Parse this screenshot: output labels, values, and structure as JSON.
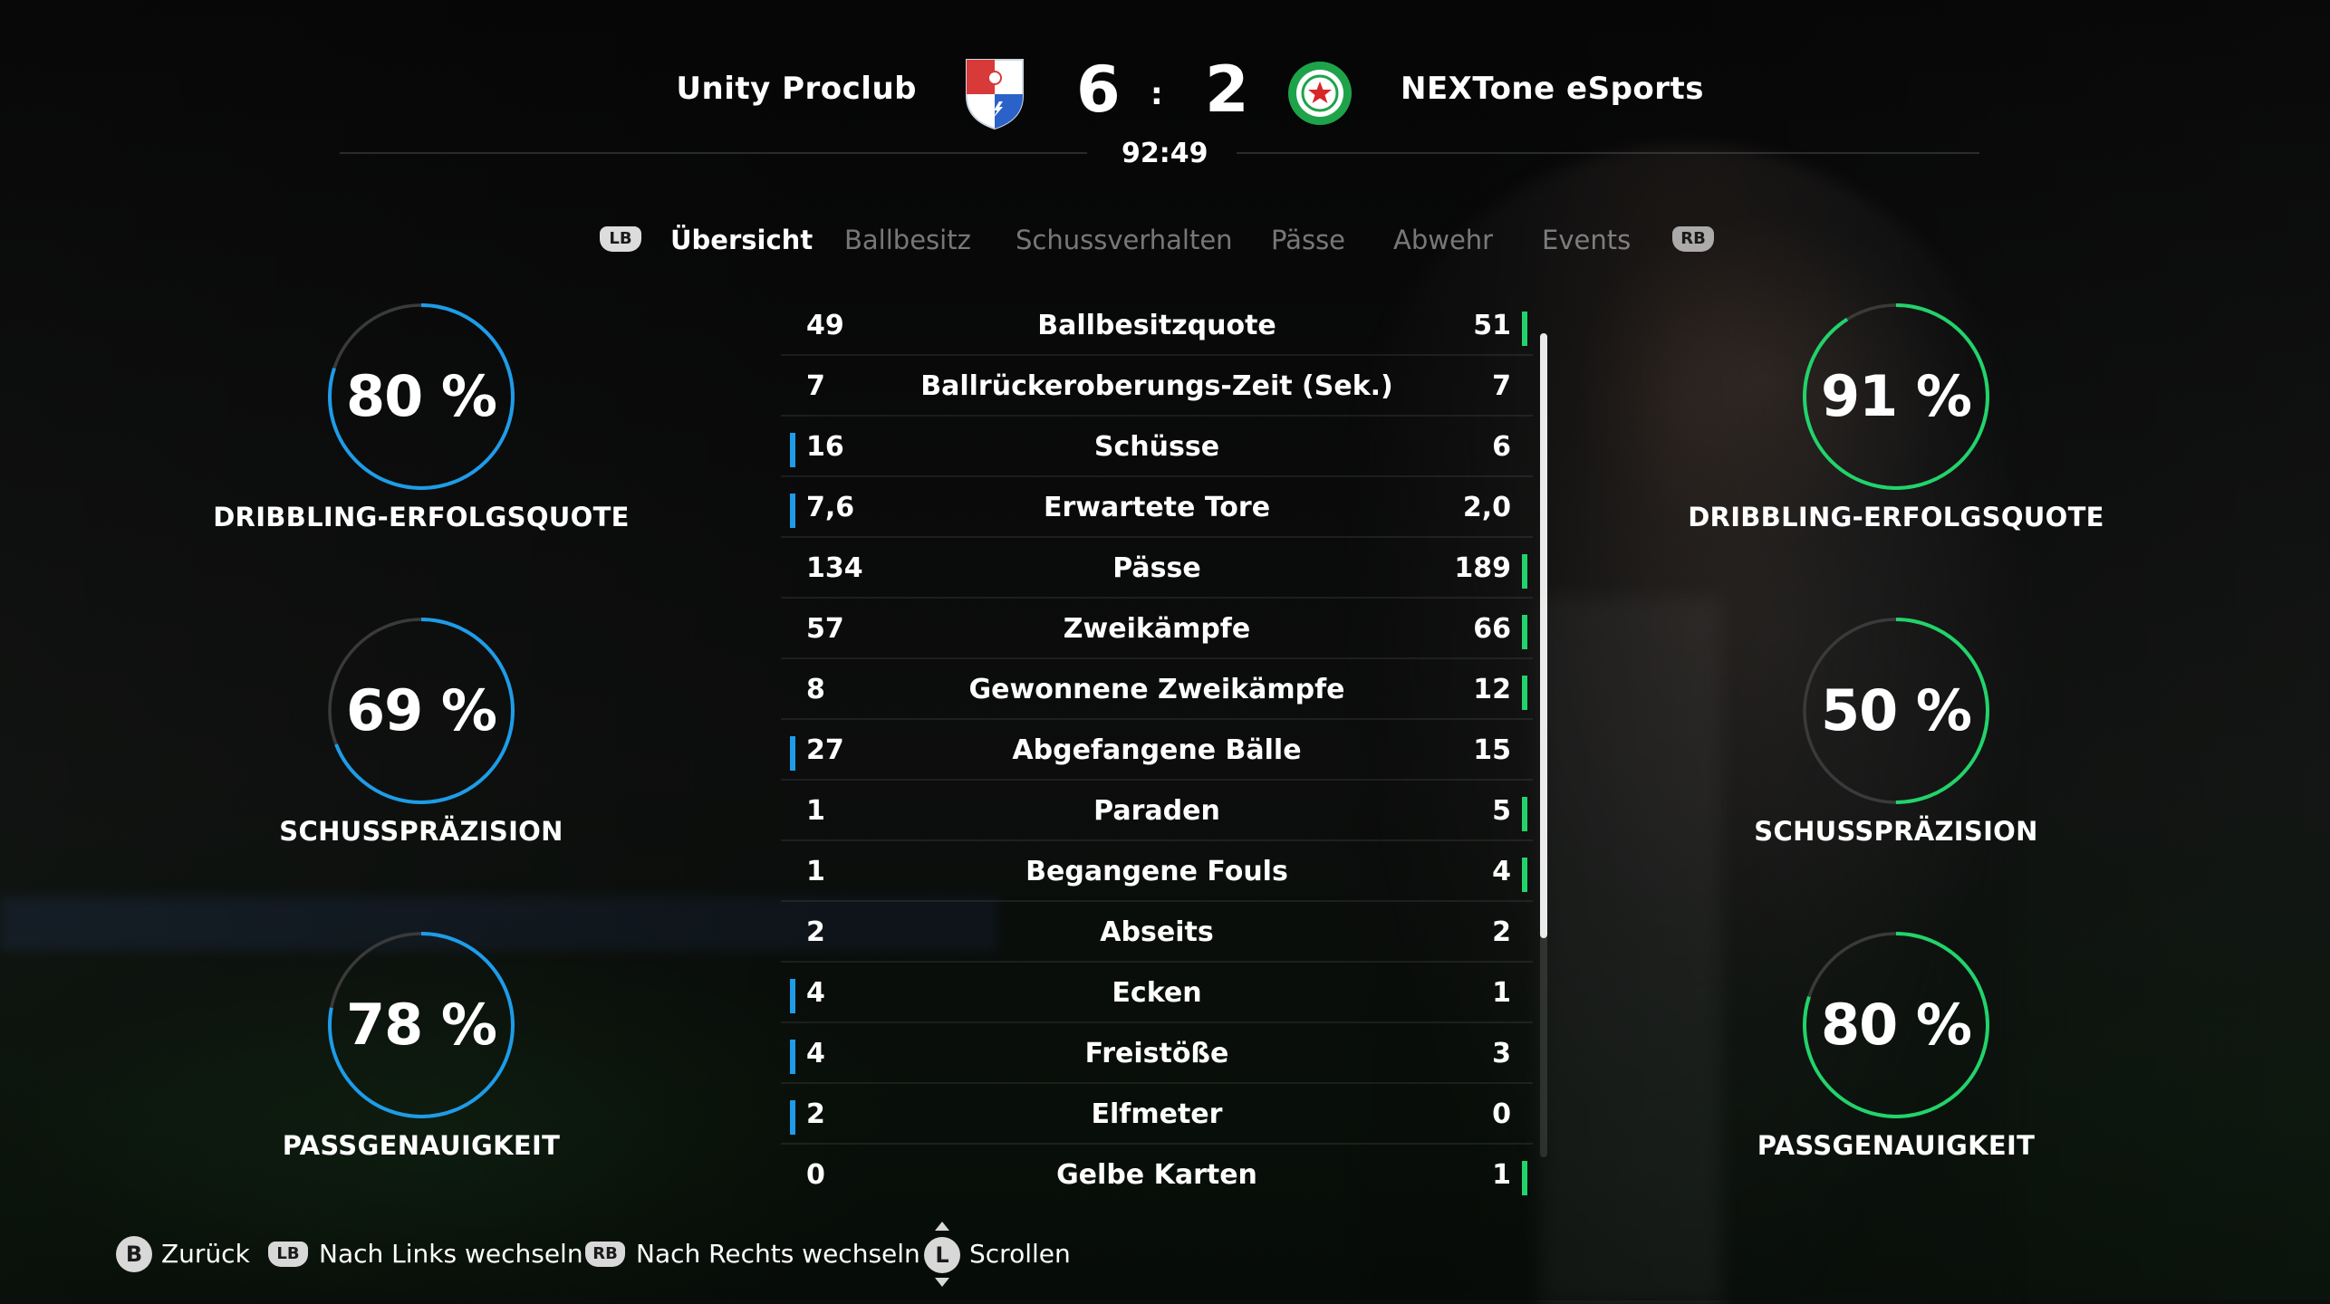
{
  "header": {
    "home_team": "Unity Proclub",
    "away_team": "NEXTone eSports",
    "home_score": "6",
    "score_separator": ":",
    "away_score": "2",
    "match_time": "92:49",
    "home_crest_icon": "red-white-blue-shield-crest-icon",
    "away_crest_icon": "green-star-round-crest-icon"
  },
  "tabs": {
    "left_button": "LB",
    "right_button": "RB",
    "items": [
      {
        "label": "Übersicht",
        "active": true
      },
      {
        "label": "Ballbesitz",
        "active": false
      },
      {
        "label": "Schussverhalten",
        "active": false
      },
      {
        "label": "Pässe",
        "active": false
      },
      {
        "label": "Abwehr",
        "active": false
      },
      {
        "label": "Events",
        "active": false
      }
    ]
  },
  "home_gauges": [
    {
      "value": "80 %",
      "percent": 80,
      "label": "DRIBBLING-ERFOLGSQUOTE"
    },
    {
      "value": "69 %",
      "percent": 69,
      "label": "SCHUSSPRÄZISION"
    },
    {
      "value": "78 %",
      "percent": 78,
      "label": "PASSGENAUIGKEIT"
    }
  ],
  "away_gauges": [
    {
      "value": "91 %",
      "percent": 91,
      "label": "DRIBBLING-ERFOLGSQUOTE"
    },
    {
      "value": "50 %",
      "percent": 50,
      "label": "SCHUSSPRÄZISION"
    },
    {
      "value": "80 %",
      "percent": 80,
      "label": "PASSGENAUIGKEIT"
    }
  ],
  "stats": [
    {
      "name": "Ballbesitzquote",
      "home": "49",
      "away": "51",
      "leader": "away"
    },
    {
      "name": "Ballrückeroberungs-Zeit (Sek.)",
      "home": "7",
      "away": "7",
      "leader": "none"
    },
    {
      "name": "Schüsse",
      "home": "16",
      "away": "6",
      "leader": "home"
    },
    {
      "name": "Erwartete Tore",
      "home": "7,6",
      "away": "2,0",
      "leader": "home"
    },
    {
      "name": "Pässe",
      "home": "134",
      "away": "189",
      "leader": "away"
    },
    {
      "name": "Zweikämpfe",
      "home": "57",
      "away": "66",
      "leader": "away"
    },
    {
      "name": "Gewonnene Zweikämpfe",
      "home": "8",
      "away": "12",
      "leader": "away"
    },
    {
      "name": "Abgefangene Bälle",
      "home": "27",
      "away": "15",
      "leader": "home"
    },
    {
      "name": "Paraden",
      "home": "1",
      "away": "5",
      "leader": "away"
    },
    {
      "name": "Begangene Fouls",
      "home": "1",
      "away": "4",
      "leader": "away"
    },
    {
      "name": "Abseits",
      "home": "2",
      "away": "2",
      "leader": "none"
    },
    {
      "name": "Ecken",
      "home": "4",
      "away": "1",
      "leader": "home"
    },
    {
      "name": "Freistöße",
      "home": "4",
      "away": "3",
      "leader": "home"
    },
    {
      "name": "Elfmeter",
      "home": "2",
      "away": "0",
      "leader": "home"
    },
    {
      "name": "Gelbe Karten",
      "home": "0",
      "away": "1",
      "leader": "away"
    }
  ],
  "footer": {
    "back_button": "B",
    "back_label": "Zurück",
    "left_button": "LB",
    "left_label": "Nach Links wechseln",
    "right_button": "RB",
    "right_label": "Nach Rechts wechseln",
    "scroll_button": "L",
    "scroll_label": "Scrollen"
  },
  "colors": {
    "home_accent": "#1e9ce8",
    "away_accent": "#22d36b",
    "ring_track": "#3a3a3a"
  }
}
